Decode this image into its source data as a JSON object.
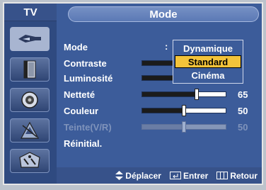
{
  "header": {
    "source": "TV",
    "title": "Mode"
  },
  "sidebar": {
    "items": [
      {
        "icon": "picture-icon",
        "active": true
      },
      {
        "icon": "sound-icon",
        "active": false
      },
      {
        "icon": "speaker-icon",
        "active": false
      },
      {
        "icon": "channel-icon",
        "active": false
      },
      {
        "icon": "setup-icon",
        "active": false
      }
    ]
  },
  "menu": {
    "mode_label": "Mode",
    "mode_colon": ":",
    "items": [
      {
        "label": "Contraste"
      },
      {
        "label": "Luminosité"
      },
      {
        "label": "Netteté",
        "value": "65"
      },
      {
        "label": "Couleur",
        "value": "50"
      },
      {
        "label": "Teinte(V/R)",
        "value": "50",
        "disabled": true
      },
      {
        "label": "Réinitial."
      }
    ]
  },
  "mode_dropdown": {
    "options": [
      "Dynamique",
      "Standard",
      "Cinéma"
    ],
    "selected": "Standard"
  },
  "sliders": {
    "nettete": 0.65,
    "couleur": 0.5,
    "teinte": 0.5
  },
  "footer": {
    "move_label": "Déplacer",
    "enter_label": "Entrer",
    "return_label": "Retour"
  },
  "colors": {
    "background": "#3c5c9a",
    "highlight": "#f3c33a"
  }
}
